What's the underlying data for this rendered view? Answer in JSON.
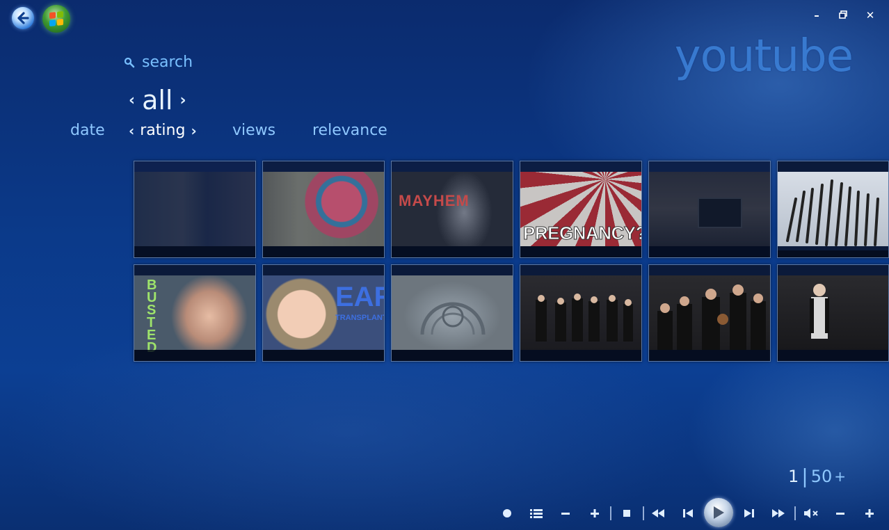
{
  "window": {
    "title": "youtube",
    "controls": {
      "minimize": "minimize-icon",
      "restore": "restore-icon",
      "close": "close-icon"
    }
  },
  "nav": {
    "back_icon": "back-arrow-icon",
    "start_icon": "windows-start-icon"
  },
  "search": {
    "icon": "search-icon",
    "label": "search"
  },
  "filter": {
    "label": "all"
  },
  "sort": {
    "options": [
      {
        "label": "date"
      },
      {
        "label": "rating"
      },
      {
        "label": "views"
      },
      {
        "label": "relevance"
      }
    ],
    "selected": "rating"
  },
  "tiles": {
    "row1": [
      {
        "caption": ""
      },
      {
        "caption": ""
      },
      {
        "caption": "MAYHEM"
      },
      {
        "caption": "PREGNANCY?!"
      },
      {
        "caption": ""
      },
      {
        "caption": ""
      }
    ],
    "row2": [
      {
        "caption": "BUSTED"
      },
      {
        "caption": "EAR",
        "subcaption": "TRANSPLANT"
      },
      {
        "caption": ""
      },
      {
        "caption": ""
      },
      {
        "caption": ""
      },
      {
        "caption": ""
      }
    ]
  },
  "pager": {
    "current": "1",
    "total": "50",
    "more": "+"
  },
  "transport": {
    "icons": [
      "record-icon",
      "playlist-icon",
      "zoom-out-icon",
      "zoom-in-icon",
      "stop-icon",
      "rewind-icon",
      "previous-icon",
      "play-icon",
      "next-icon",
      "fast-forward-icon",
      "mute-icon",
      "volume-down-icon",
      "volume-up-icon"
    ]
  },
  "colors": {
    "accent": "#79c0ff",
    "background": "#0c3a8a",
    "title": "#3b7fd6"
  }
}
